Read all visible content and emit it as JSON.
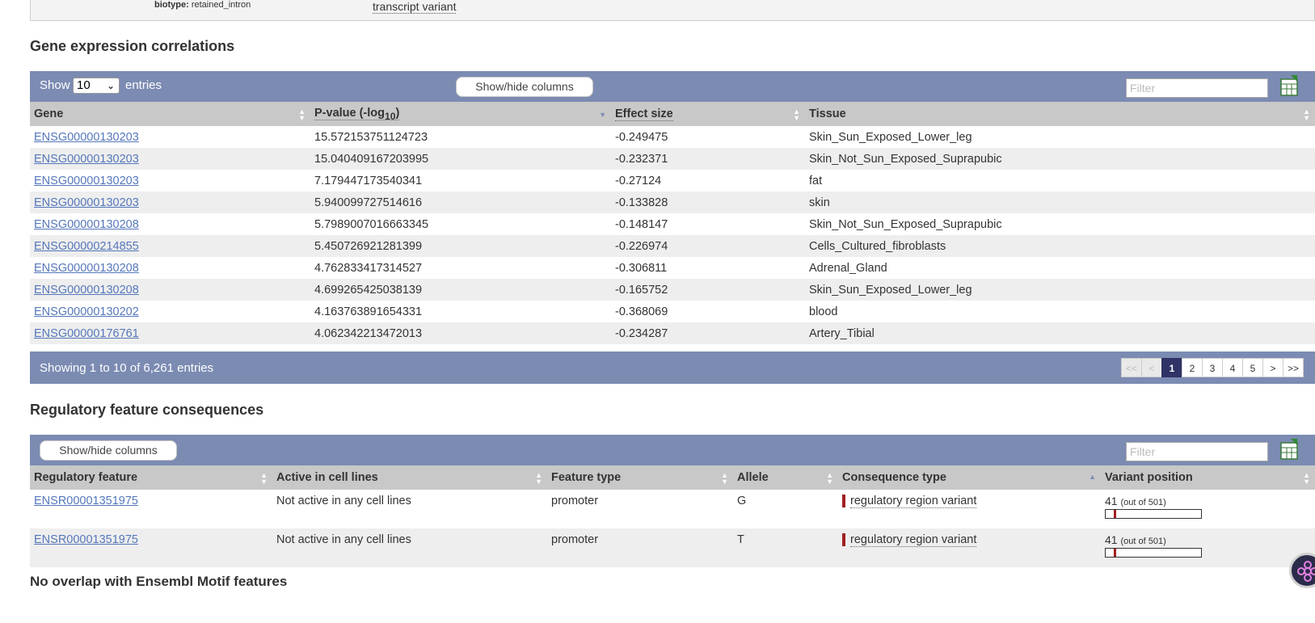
{
  "top": {
    "biotype_label": "biotype:",
    "biotype_value": "retained_intron",
    "consequence": "transcript variant"
  },
  "gene_expr": {
    "title": "Gene expression correlations",
    "show_label": "Show",
    "entries_value": "10",
    "entries_label": "entries",
    "showhide_label": "Show/hide columns",
    "filter_placeholder": "Filter",
    "columns": {
      "gene": "Gene",
      "pvalue": "P-value (-log",
      "pvalue_sub": "10",
      "pvalue_close": ")",
      "effect": "Effect size",
      "tissue": "Tissue"
    },
    "rows": [
      {
        "gene": "ENSG00000130203",
        "p": "15.572153751124723",
        "e": "-0.249475",
        "t": "Skin_Sun_Exposed_Lower_leg"
      },
      {
        "gene": "ENSG00000130203",
        "p": "15.040409167203995",
        "e": "-0.232371",
        "t": "Skin_Not_Sun_Exposed_Suprapubic"
      },
      {
        "gene": "ENSG00000130203",
        "p": "7.179447173540341",
        "e": "-0.27124",
        "t": "fat"
      },
      {
        "gene": "ENSG00000130203",
        "p": "5.940099727514616",
        "e": "-0.133828",
        "t": "skin"
      },
      {
        "gene": "ENSG00000130208",
        "p": "5.7989007016663345",
        "e": "-0.148147",
        "t": "Skin_Not_Sun_Exposed_Suprapubic"
      },
      {
        "gene": "ENSG00000214855",
        "p": "5.450726921281399",
        "e": "-0.226974",
        "t": "Cells_Cultured_fibroblasts"
      },
      {
        "gene": "ENSG00000130208",
        "p": "4.762833417314527",
        "e": "-0.306811",
        "t": "Adrenal_Gland"
      },
      {
        "gene": "ENSG00000130208",
        "p": "4.699265425038139",
        "e": "-0.165752",
        "t": "Skin_Sun_Exposed_Lower_leg"
      },
      {
        "gene": "ENSG00000130202",
        "p": "4.163763891654331",
        "e": "-0.368069",
        "t": "blood"
      },
      {
        "gene": "ENSG00000176761",
        "p": "4.062342213472013",
        "e": "-0.234287",
        "t": "Artery_Tibial"
      }
    ],
    "info": "Showing 1 to 10 of 6,261 entries",
    "pager": {
      "first": "<<",
      "prev": "<",
      "pages": [
        "1",
        "2",
        "3",
        "4",
        "5"
      ],
      "current": "1",
      "next": ">",
      "last": ">>"
    }
  },
  "reg": {
    "title": "Regulatory feature consequences",
    "showhide_label": "Show/hide columns",
    "filter_placeholder": "Filter",
    "columns": {
      "feature": "Regulatory feature",
      "active": "Active in cell lines",
      "ftype": "Feature type",
      "allele": "Allele",
      "ctype": "Consequence type",
      "vpos": "Variant position"
    },
    "rows": [
      {
        "feature": "ENSR00001351975",
        "active": "Not active in any cell lines",
        "ftype": "promoter",
        "allele": "G",
        "ctype": "regulatory region variant",
        "pos": "41",
        "of": "(out of 501)",
        "fraction": 0.0818
      },
      {
        "feature": "ENSR00001351975",
        "active": "Not active in any cell lines",
        "ftype": "promoter",
        "allele": "T",
        "ctype": "regulatory region variant",
        "pos": "41",
        "of": "(out of 501)",
        "fraction": 0.0818
      }
    ],
    "consequence_color": "#a02020"
  },
  "motif": {
    "title": "No overlap with Ensembl Motif features"
  },
  "colors": {
    "panel": "#7b8bb2",
    "header": "#c8c8c8",
    "link": "#5577bb",
    "pager_current": "#2f3366"
  }
}
